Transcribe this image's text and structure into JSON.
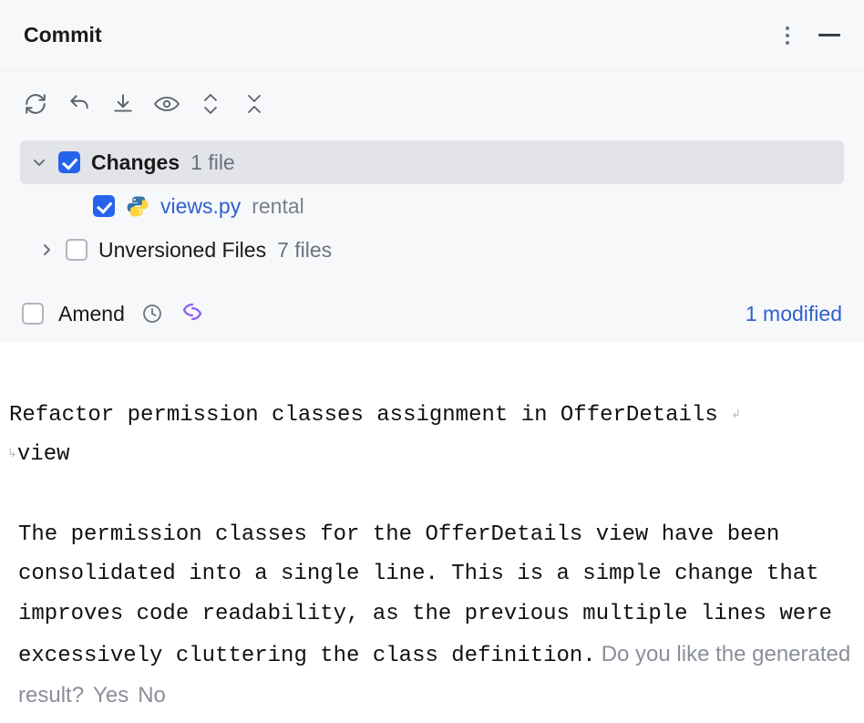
{
  "header": {
    "title": "Commit"
  },
  "toolbar": {
    "icons": [
      "refresh",
      "undo",
      "download",
      "eye",
      "expand",
      "collapse"
    ]
  },
  "tree": {
    "changes": {
      "label": "Changes",
      "count": "1 file",
      "checked": true,
      "expanded": true,
      "items": [
        {
          "file": "views.py",
          "dir": "rental",
          "checked": true
        }
      ]
    },
    "unversioned": {
      "label": "Unversioned Files",
      "count": "7 files",
      "checked": false,
      "expanded": false
    }
  },
  "options": {
    "amend_label": "Amend",
    "amend_checked": false,
    "status": "1 modified"
  },
  "message": {
    "title_line": "Refactor permission classes assignment in OfferDetails",
    "title_wrap": "view",
    "body": "The permission classes for the OfferDetails view have been consolidated into a single line. This is a simple change that improves code readability, as the previous multiple lines were excessively cluttering the class definition.",
    "feedback_prompt": "Do you like the generated result?",
    "feedback_yes": "Yes",
    "feedback_no": "No"
  }
}
